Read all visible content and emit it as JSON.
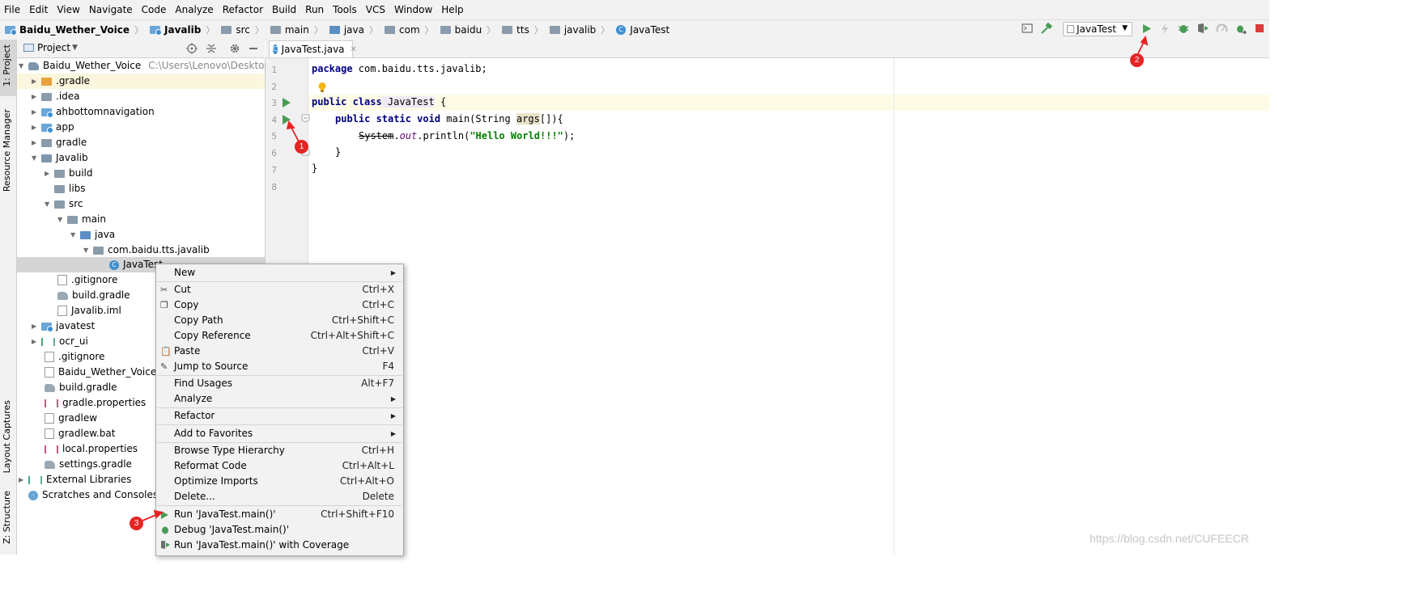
{
  "menubar": [
    "File",
    "Edit",
    "View",
    "Navigate",
    "Code",
    "Analyze",
    "Refactor",
    "Build",
    "Run",
    "Tools",
    "VCS",
    "Window",
    "Help"
  ],
  "breadcrumbs": [
    "Baidu_Wether_Voice",
    "Javalib",
    "src",
    "main",
    "java",
    "com",
    "baidu",
    "tts",
    "javalib",
    "JavaTest"
  ],
  "toolbar": {
    "run_config": "JavaTest"
  },
  "left_strip": {
    "project_tab": "1: Project",
    "resource_manager": "Resource Manager",
    "layout_captures": "Layout Captures",
    "structure_tab": "Z: Structure"
  },
  "project_panel": {
    "title": "Project"
  },
  "tree": [
    {
      "label": "Baidu_Wether_Voice",
      "note": "C:\\Users\\Lenovo\\Desktop\\Stu"
    },
    {
      "label": ".gradle"
    },
    {
      "label": ".idea"
    },
    {
      "label": "ahbottomnavigation"
    },
    {
      "label": "app"
    },
    {
      "label": "gradle"
    },
    {
      "label": "Javalib"
    },
    {
      "label": "build"
    },
    {
      "label": "libs"
    },
    {
      "label": "src"
    },
    {
      "label": "main"
    },
    {
      "label": "java"
    },
    {
      "label": "com.baidu.tts.javalib"
    },
    {
      "label": "JavaTest"
    },
    {
      "label": ".gitignore"
    },
    {
      "label": "build.gradle"
    },
    {
      "label": "Javalib.iml"
    },
    {
      "label": "javatest"
    },
    {
      "label": "ocr_ui"
    },
    {
      "label": ".gitignore"
    },
    {
      "label": "Baidu_Wether_Voice.im"
    },
    {
      "label": "build.gradle"
    },
    {
      "label": "gradle.properties"
    },
    {
      "label": "gradlew"
    },
    {
      "label": "gradlew.bat"
    },
    {
      "label": "local.properties"
    },
    {
      "label": "settings.gradle"
    },
    {
      "label": "External Libraries"
    },
    {
      "label": "Scratches and Consoles"
    }
  ],
  "editor": {
    "tab_label": "JavaTest.java",
    "line_numbers": [
      "1",
      "2",
      "3",
      "4",
      "5",
      "6",
      "7",
      "8"
    ],
    "code": {
      "l1_kw": "package",
      "l1_rest": " com.baidu.tts.javalib;",
      "l3_kw": "public class",
      "l3_name": " JavaTest",
      "l3_rest": " {",
      "l4_kw": "public static void",
      "l4_a": " main(String ",
      "l4_param": "args",
      "l4_b": "[]){",
      "l5_sys": "System",
      "l5_dot": ".",
      "l5_out": "out",
      "l5_call": ".println(",
      "l5_str": "\"Hello World!!!\"",
      "l5_end": ");",
      "l6": "}",
      "l7": "}"
    }
  },
  "context_menu": {
    "items": [
      {
        "label": "New",
        "shortcut": ""
      },
      {
        "label": "Cut",
        "shortcut": "Ctrl+X"
      },
      {
        "label": "Copy",
        "shortcut": "Ctrl+C"
      },
      {
        "label": "Copy Path",
        "shortcut": "Ctrl+Shift+C"
      },
      {
        "label": "Copy Reference",
        "shortcut": "Ctrl+Alt+Shift+C"
      },
      {
        "label": "Paste",
        "shortcut": "Ctrl+V"
      },
      {
        "label": "Jump to Source",
        "shortcut": "F4"
      },
      {
        "label": "Find Usages",
        "shortcut": "Alt+F7"
      },
      {
        "label": "Analyze",
        "shortcut": ""
      },
      {
        "label": "Refactor",
        "shortcut": ""
      },
      {
        "label": "Add to Favorites",
        "shortcut": ""
      },
      {
        "label": "Browse Type Hierarchy",
        "shortcut": "Ctrl+H"
      },
      {
        "label": "Reformat Code",
        "shortcut": "Ctrl+Alt+L"
      },
      {
        "label": "Optimize Imports",
        "shortcut": "Ctrl+Alt+O"
      },
      {
        "label": "Delete...",
        "shortcut": "Delete"
      },
      {
        "label": "Run 'JavaTest.main()'",
        "shortcut": "Ctrl+Shift+F10"
      },
      {
        "label": "Debug 'JavaTest.main()'",
        "shortcut": ""
      },
      {
        "label": "Run 'JavaTest.main()' with Coverage",
        "shortcut": ""
      }
    ]
  },
  "annotations": {
    "badge1": "1",
    "badge2": "2",
    "badge3": "3",
    "color": "#e52424"
  },
  "watermark": "https://blog.csdn.net/CUFEECR",
  "colors": {
    "run_green": "#499c54",
    "keyword": "#000080",
    "string": "#008000",
    "field": "#660e7a"
  }
}
